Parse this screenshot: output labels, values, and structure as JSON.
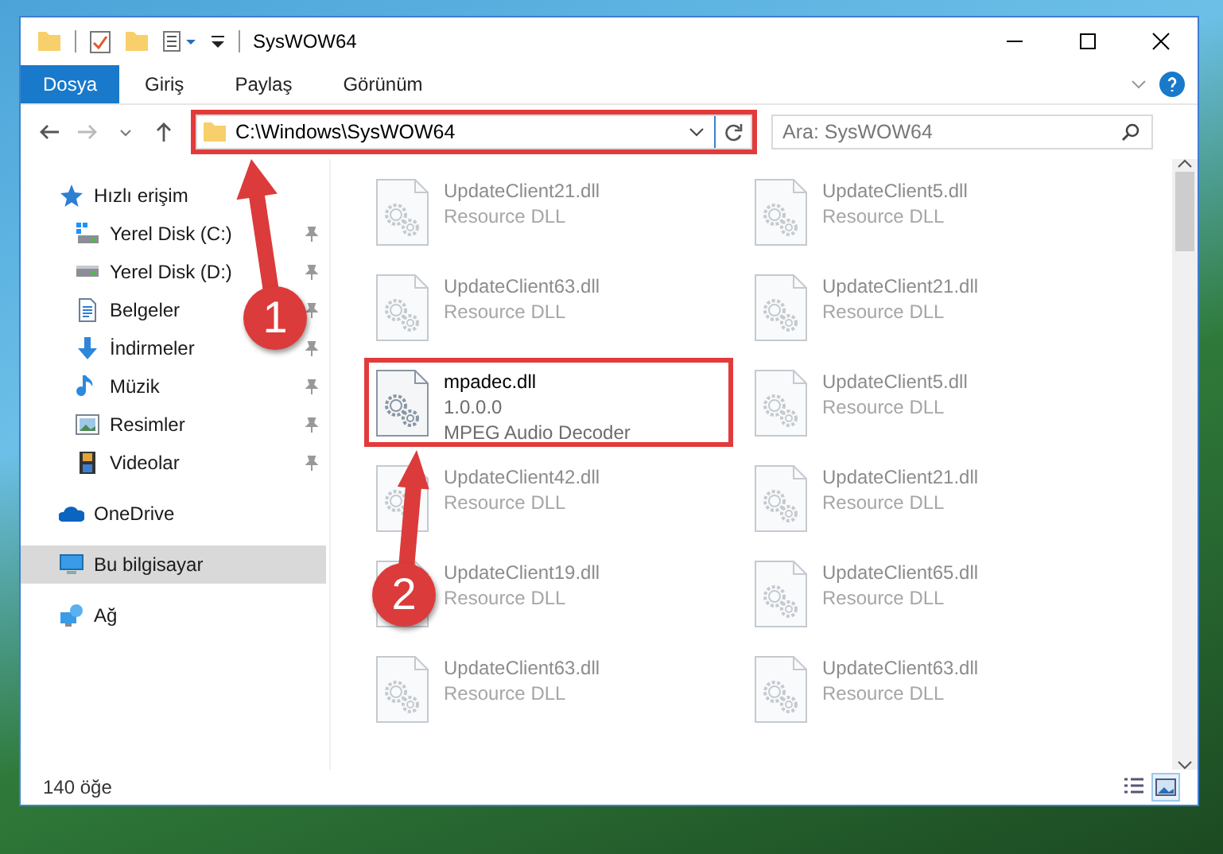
{
  "window": {
    "title": "SysWOW64"
  },
  "ribbon_tabs": [
    {
      "label": "Dosya",
      "selected": true
    },
    {
      "label": "Giriş",
      "selected": false
    },
    {
      "label": "Paylaş",
      "selected": false
    },
    {
      "label": "Görünüm",
      "selected": false
    }
  ],
  "address_bar": {
    "path": "C:\\Windows\\SysWOW64",
    "highlighted": true
  },
  "search": {
    "placeholder": "Ara: SysWOW64"
  },
  "sidebar": {
    "items": [
      {
        "label": "Hızlı erişim",
        "selected": false,
        "children": [
          {
            "label": "Yerel Disk (C:)",
            "pinned": true,
            "selected": false
          },
          {
            "label": "Yerel Disk (D:)",
            "pinned": true,
            "selected": false
          },
          {
            "label": "Belgeler",
            "pinned": true,
            "selected": false
          },
          {
            "label": "İndirmeler",
            "pinned": true,
            "selected": false
          },
          {
            "label": "Müzik",
            "pinned": true,
            "selected": false
          },
          {
            "label": "Resimler",
            "pinned": true,
            "selected": false
          },
          {
            "label": "Videolar",
            "pinned": true,
            "selected": false
          }
        ]
      },
      {
        "label": "OneDrive",
        "selected": false
      },
      {
        "label": "Bu bilgisayar",
        "selected": true
      },
      {
        "label": "Ağ",
        "selected": false
      }
    ]
  },
  "files": [
    {
      "name": "UpdateClient21.dll",
      "lines": [
        "Resource DLL"
      ],
      "kind": "blurred",
      "highlighted": false
    },
    {
      "name": "UpdateClient5.dll",
      "lines": [
        "Resource DLL"
      ],
      "kind": "blurred",
      "highlighted": false
    },
    {
      "name": "UpdateClient63.dll",
      "lines": [
        "Resource DLL"
      ],
      "kind": "blurred",
      "highlighted": false
    },
    {
      "name": "UpdateClient21.dll",
      "lines": [
        "Resource DLL"
      ],
      "kind": "blurred",
      "highlighted": false
    },
    {
      "name": "mpadec.dll",
      "lines": [
        "1.0.0.0",
        "MPEG Audio Decoder"
      ],
      "kind": "normal",
      "highlighted": true
    },
    {
      "name": "UpdateClient5.dll",
      "lines": [
        "Resource DLL"
      ],
      "kind": "blurred",
      "highlighted": false
    },
    {
      "name": "UpdateClient42.dll",
      "lines": [
        "Resource DLL"
      ],
      "kind": "blurred",
      "highlighted": false
    },
    {
      "name": "UpdateClient21.dll",
      "lines": [
        "Resource DLL"
      ],
      "kind": "blurred",
      "highlighted": false
    },
    {
      "name": "UpdateClient19.dll",
      "lines": [
        "Resource DLL"
      ],
      "kind": "blurred",
      "highlighted": false
    },
    {
      "name": "UpdateClient65.dll",
      "lines": [
        "Resource DLL"
      ],
      "kind": "blurred",
      "highlighted": false
    },
    {
      "name": "UpdateClient63.dll",
      "lines": [
        "Resource DLL"
      ],
      "kind": "blurred",
      "highlighted": false
    },
    {
      "name": "UpdateClient63.dll",
      "lines": [
        "Resource DLL"
      ],
      "kind": "blurred",
      "highlighted": false
    }
  ],
  "annotations": [
    {
      "number": "1"
    },
    {
      "number": "2"
    }
  ],
  "status_bar": {
    "item_count": "140 öğe",
    "view_buttons": [
      {
        "kind": "details",
        "selected": false
      },
      {
        "kind": "tiles",
        "selected": true
      }
    ]
  }
}
